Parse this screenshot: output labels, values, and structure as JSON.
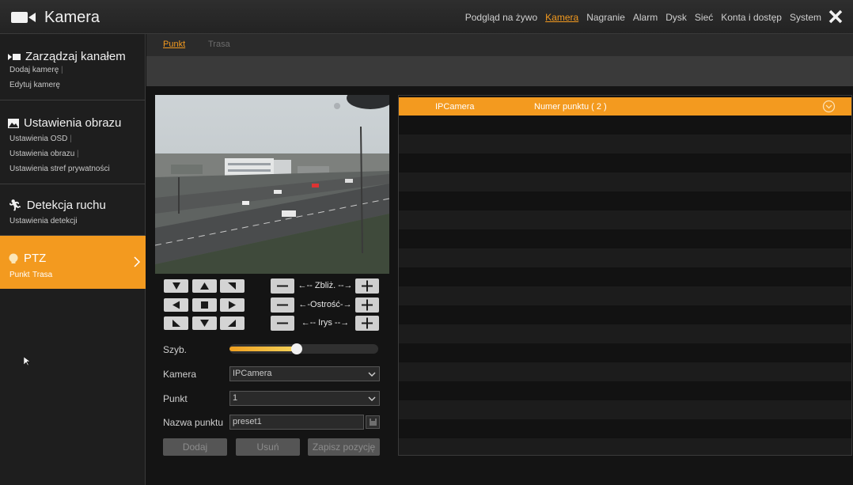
{
  "app": {
    "title": "Kamera",
    "close_glyph": "✕"
  },
  "topnav": [
    {
      "label": "Podgląd na żywo",
      "active": false
    },
    {
      "label": "Kamera",
      "active": true
    },
    {
      "label": "Nagranie",
      "active": false
    },
    {
      "label": "Alarm",
      "active": false
    },
    {
      "label": "Dysk",
      "active": false
    },
    {
      "label": "Sieć",
      "active": false
    },
    {
      "label": "Konta i dostęp",
      "active": false
    },
    {
      "label": "System",
      "active": false
    }
  ],
  "sidebar": {
    "sections": [
      {
        "title": "Zarządzaj kanałem",
        "icon": "channel-icon",
        "items": [
          "Dodaj kamerę",
          "Edytuj kamerę"
        ]
      },
      {
        "title": "Ustawienia obrazu",
        "icon": "image-icon",
        "items": [
          "Ustawienia OSD",
          "Ustawienia obrazu",
          "Ustawienia stref prywatności"
        ]
      },
      {
        "title": "Detekcja ruchu",
        "icon": "running-man-icon",
        "items": [
          "Ustawienia detekcji"
        ]
      },
      {
        "title": "PTZ",
        "icon": "ptz-bulb-icon",
        "items": [
          "Punkt",
          "Trasa"
        ],
        "active": true
      }
    ],
    "separator": "|"
  },
  "tabs": [
    {
      "label": "Punkt",
      "active": true
    },
    {
      "label": "Trasa",
      "active": false
    }
  ],
  "ptz": {
    "zoom_label": "←-- Zbliż. --→",
    "focus_label": "←-Ostrość-→",
    "iris_label": "←-- Irys --→",
    "speed_label": "Szyb.",
    "speed_value": 0.45,
    "camera_label": "Kamera",
    "camera_value": "IPCamera",
    "point_label": "Punkt",
    "point_value": "1",
    "point_name_label": "Nazwa punktu",
    "point_name_value": "preset1",
    "add_button": "Dodaj",
    "delete_button": "Usuń",
    "save_position_button": "Zapisz pozycję"
  },
  "table": {
    "columns": [
      "IPCamera",
      "Numer punktu ( 2 )"
    ],
    "rows": []
  },
  "colors": {
    "accent": "#f39a1f",
    "background": "#141414",
    "sidebar": "#1e1e1e"
  }
}
